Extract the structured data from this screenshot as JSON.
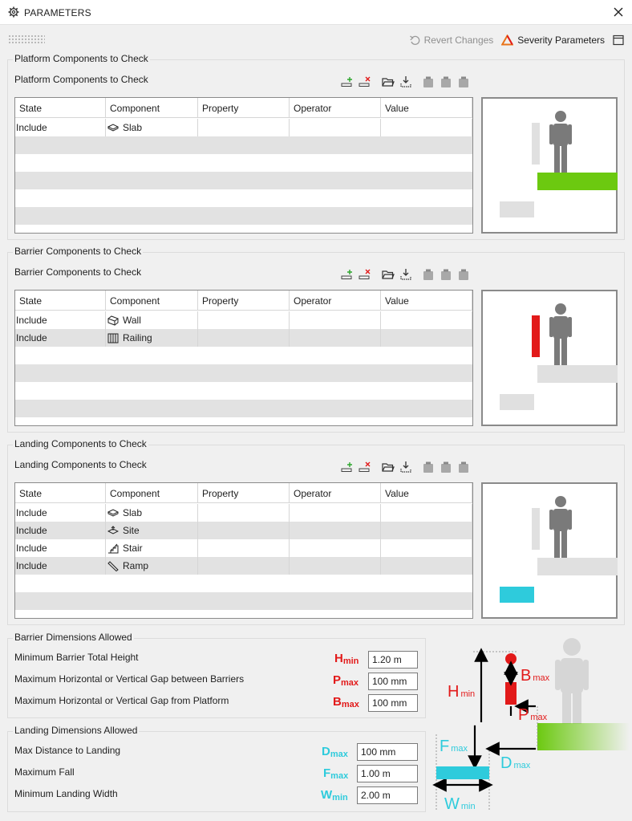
{
  "window": {
    "title": "PARAMETERS"
  },
  "toolbar": {
    "revert_label": "Revert Changes",
    "severity_label": "Severity Parameters"
  },
  "columns": [
    "State",
    "Component",
    "Property",
    "Operator",
    "Value"
  ],
  "platform": {
    "group_title": "Platform Components to Check",
    "sub_title": "Platform Components to Check",
    "rows": [
      {
        "state": "Include",
        "component": "Slab",
        "icon": "slab-icon"
      }
    ]
  },
  "barrier": {
    "group_title": "Barrier Components to Check",
    "sub_title": "Barrier Components to Check",
    "rows": [
      {
        "state": "Include",
        "component": "Wall",
        "icon": "wall-icon"
      },
      {
        "state": "Include",
        "component": "Railing",
        "icon": "railing-icon"
      }
    ]
  },
  "landing": {
    "group_title": "Landing Components to Check",
    "sub_title": "Landing Components to Check",
    "rows": [
      {
        "state": "Include",
        "component": "Slab",
        "icon": "slab-icon"
      },
      {
        "state": "Include",
        "component": "Site",
        "icon": "site-icon"
      },
      {
        "state": "Include",
        "component": "Stair",
        "icon": "stair-icon"
      },
      {
        "state": "Include",
        "component": "Ramp",
        "icon": "ramp-icon"
      }
    ]
  },
  "barrier_dims": {
    "title": "Barrier Dimensions Allowed",
    "rows": [
      {
        "label": "Minimum Barrier Total Height",
        "sym": "H",
        "sub": "min",
        "value": "1.20 m"
      },
      {
        "label": "Maximum Horizontal or Vertical Gap between Barriers",
        "sym": "P",
        "sub": "max",
        "value": "100 mm"
      },
      {
        "label": "Maximum Horizontal or Vertical Gap from Platform",
        "sym": "B",
        "sub": "max",
        "value": "100 mm"
      }
    ]
  },
  "landing_dims": {
    "title": "Landing Dimensions Allowed",
    "rows": [
      {
        "label": "Max Distance to Landing",
        "sym": "D",
        "sub": "max",
        "value": "100 mm"
      },
      {
        "label": "Maximum Fall",
        "sym": "F",
        "sub": "max",
        "value": "1.00 m"
      },
      {
        "label": "Minimum Landing Width",
        "sym": "W",
        "sub": "min",
        "value": "2.00 m"
      }
    ]
  },
  "diagram": {
    "H": "H",
    "H_sub": "min",
    "B": "B",
    "B_sub": "max",
    "P": "P",
    "P_sub": "max",
    "F": "F",
    "F_sub": "max",
    "D": "D",
    "D_sub": "max",
    "W": "W",
    "W_sub": "min"
  },
  "colors": {
    "red": "#e21a1a",
    "cyan": "#2ecbdc",
    "green": "#6cc910",
    "figure": "#7a7a7a"
  }
}
